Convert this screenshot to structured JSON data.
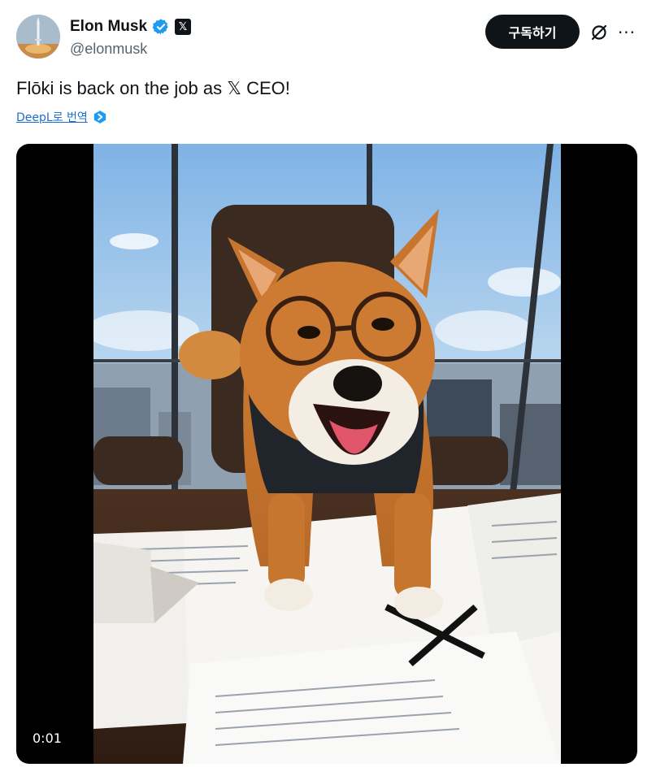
{
  "author": {
    "display_name": "Elon Musk",
    "handle": "@elonmusk",
    "verified_icon": "verified-badge-icon",
    "affiliation_icon": "x-logo-icon",
    "affiliation_glyph": "𝕏"
  },
  "actions": {
    "subscribe_label": "구독하기",
    "grok_icon": "grok-icon",
    "more_label": "···"
  },
  "tweet": {
    "text": "Flōki is back on the job as 𝕏 CEO!",
    "translate_label": "DeepL로 번역",
    "translate_icon": "deepl-icon"
  },
  "media": {
    "type": "video",
    "timestamp": "0:01",
    "description_icon": "video-thumbnail"
  },
  "colors": {
    "accent": "#1d9bf0",
    "link": "#1d6fcf",
    "button_bg": "#0f1419",
    "secondary_text": "#536471"
  }
}
